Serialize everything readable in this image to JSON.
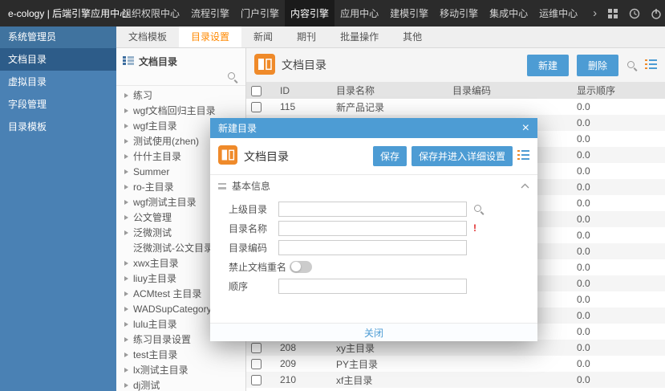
{
  "topbar": {
    "brand": "e-cology | 后端引擎应用中心",
    "menu": [
      {
        "label": "组织权限中心",
        "active": false
      },
      {
        "label": "流程引擎",
        "active": false
      },
      {
        "label": "门户引擎",
        "active": false
      },
      {
        "label": "内容引擎",
        "active": true
      },
      {
        "label": "应用中心",
        "active": false
      },
      {
        "label": "建模引擎",
        "active": false
      },
      {
        "label": "移动引擎",
        "active": false
      },
      {
        "label": "集成中心",
        "active": false
      },
      {
        "label": "运维中心",
        "active": false
      }
    ],
    "overflow_arrow": "›"
  },
  "tabbar": {
    "tabs": [
      {
        "label": "文档模板",
        "active": false
      },
      {
        "label": "目录设置",
        "active": true
      },
      {
        "label": "新闻",
        "active": false
      },
      {
        "label": "期刊",
        "active": false
      },
      {
        "label": "批量操作",
        "active": false
      },
      {
        "label": "其他",
        "active": false
      }
    ]
  },
  "sidebar": {
    "header": "系统管理员",
    "items": [
      {
        "label": "文档目录",
        "active": true
      },
      {
        "label": "虚拟目录",
        "active": false
      },
      {
        "label": "字段管理",
        "active": false
      },
      {
        "label": "目录模板",
        "active": false
      }
    ]
  },
  "tree": {
    "title": "文档目录",
    "items": [
      {
        "label": "练习",
        "arrow": true
      },
      {
        "label": "wgf文档回归主目录",
        "arrow": true
      },
      {
        "label": "wgf主目录",
        "arrow": true
      },
      {
        "label": "测试使用(zhen)",
        "arrow": true
      },
      {
        "label": "什什主目录",
        "arrow": true
      },
      {
        "label": "Summer",
        "arrow": true
      },
      {
        "label": "ro-主目录",
        "arrow": true
      },
      {
        "label": "wgf测试主目录",
        "arrow": true
      },
      {
        "label": "公文管理",
        "arrow": true
      },
      {
        "label": "泛微测试",
        "arrow": true
      },
      {
        "label": "泛微测试-公文目录",
        "arrow": false
      },
      {
        "label": "xwx主目录",
        "arrow": true
      },
      {
        "label": "liuy主目录",
        "arrow": true
      },
      {
        "label": "ACMtest 主目录",
        "arrow": true
      },
      {
        "label": "WADSupCategory",
        "arrow": true
      },
      {
        "label": "lulu主目录",
        "arrow": true
      },
      {
        "label": "练习目录设置",
        "arrow": true
      },
      {
        "label": "test主目录",
        "arrow": true
      },
      {
        "label": "lx测试主目录",
        "arrow": true
      },
      {
        "label": "dj测试",
        "arrow": true
      }
    ]
  },
  "main": {
    "title": "文档目录",
    "new_button": "新建",
    "delete_button": "删除",
    "table": {
      "headers": {
        "id": "ID",
        "name": "目录名称",
        "code": "目录编码",
        "order": "显示顺序"
      },
      "rows": [
        {
          "id": "115",
          "name": "新产品记录",
          "code": "",
          "order": "0.0"
        },
        {
          "id": "",
          "name": "",
          "code": "",
          "order": "0.0"
        },
        {
          "id": "",
          "name": "",
          "code": "",
          "order": "0.0"
        },
        {
          "id": "",
          "name": "",
          "code": "",
          "order": "0.0"
        },
        {
          "id": "",
          "name": "",
          "code": "",
          "order": "0.0"
        },
        {
          "id": "",
          "name": "",
          "code": "",
          "order": "0.0"
        },
        {
          "id": "",
          "name": "",
          "code": "",
          "order": "0.0"
        },
        {
          "id": "",
          "name": "",
          "code": "",
          "order": "0.0"
        },
        {
          "id": "",
          "name": "",
          "code": "",
          "order": "0.0"
        },
        {
          "id": "",
          "name": "",
          "code": "",
          "order": "0.0"
        },
        {
          "id": "",
          "name": "",
          "code": "",
          "order": "0.0"
        },
        {
          "id": "",
          "name": "",
          "code": "",
          "order": "0.0"
        },
        {
          "id": "",
          "name": "",
          "code": "",
          "order": "0.0"
        },
        {
          "id": "",
          "name": "",
          "code": "",
          "order": "0.0"
        },
        {
          "id": "",
          "name": "",
          "code": "",
          "order": "0.0"
        },
        {
          "id": "208",
          "name": "xy主目录",
          "code": "",
          "order": "0.0"
        },
        {
          "id": "209",
          "name": "PY主目录",
          "code": "",
          "order": "0.0"
        },
        {
          "id": "210",
          "name": "xf主目录",
          "code": "",
          "order": "0.0"
        }
      ]
    }
  },
  "modal": {
    "title": "新建目录",
    "close_icon": "×",
    "panel_title": "文档目录",
    "save_button": "保存",
    "save_detail_button": "保存并进入详细设置",
    "section_title": "基本信息",
    "required_marker": "!",
    "fields": [
      {
        "label": "上级目录",
        "type": "search",
        "value": ""
      },
      {
        "label": "目录名称",
        "type": "required",
        "value": ""
      },
      {
        "label": "目录编码",
        "type": "text",
        "value": ""
      },
      {
        "label": "禁止文档重名",
        "type": "toggle",
        "value": false
      },
      {
        "label": "顺序",
        "type": "text",
        "value": ""
      }
    ],
    "footer_close": "关闭"
  },
  "colors": {
    "topbar_dark": "#2b2b2b",
    "sidebar_blue": "#4a81b4",
    "sidebar_active": "#2d5c89",
    "accent_blue": "#4d9cd4",
    "accent_orange": "#ef8a2a",
    "active_tab_orange": "#ff8800"
  }
}
